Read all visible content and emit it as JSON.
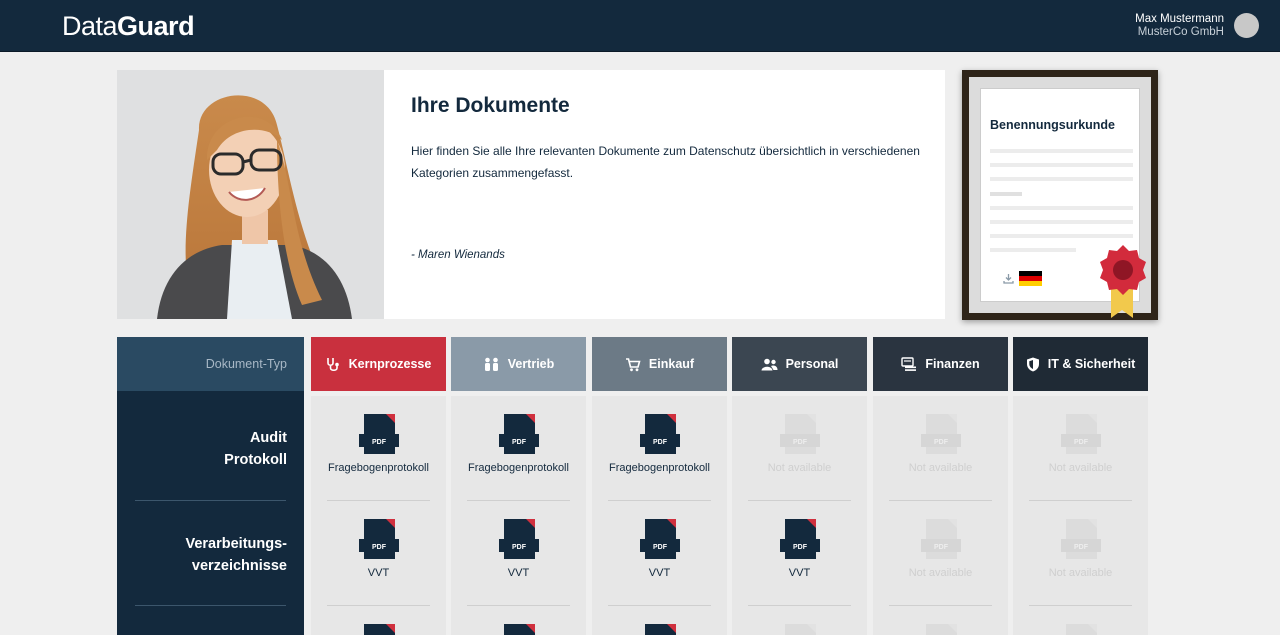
{
  "header": {
    "logo_part1": "Data",
    "logo_part2": "Guard",
    "user_name": "Max Mustermann",
    "company": "MusterCo GmbH"
  },
  "hero": {
    "title": "Ihre Dokumente",
    "text": "Hier finden Sie alle Ihre relevanten Dokumente zum Datenschutz übersichtlich in verschiedenen Kategorien zusammengefasst.",
    "quote": "- Maren Wienands"
  },
  "certificate": {
    "title": "Benennungsurkunde",
    "icon": "download-icon",
    "language_flag": "de-flag"
  },
  "table": {
    "corner_label": "Dokument-Typ",
    "columns": [
      {
        "label": "Kernprozesse",
        "color": "#c9303e",
        "icon": "stethoscope-icon"
      },
      {
        "label": "Vertrieb",
        "color": "#8a9aa8",
        "icon": "people-icon"
      },
      {
        "label": "Einkauf",
        "color": "#6c7a86",
        "icon": "cart-icon"
      },
      {
        "label": "Personal",
        "color": "#3b4651",
        "icon": "users-icon"
      },
      {
        "label": "Finanzen",
        "color": "#2a3440",
        "icon": "money-icon"
      },
      {
        "label": "IT & Sicherheit",
        "color": "#1f2a35",
        "icon": "shield-icon"
      }
    ],
    "rows": [
      {
        "label_line1": "Audit",
        "label_line2": "Protokoll",
        "cells": [
          "Fragebogenprotokoll",
          "Fragebogenprotokoll",
          "Fragebogenprotokoll",
          "Not available",
          "Not available",
          "Not available"
        ]
      },
      {
        "label_line1": "Verarbeitungs-",
        "label_line2": "verzeichnisse",
        "cells": [
          "VVT",
          "VVT",
          "VVT",
          "VVT",
          "Not available",
          "Not available"
        ]
      }
    ],
    "pdf_badge": "PDF"
  },
  "colors": {
    "navy": "#13293d",
    "accent_red": "#c9303e",
    "seal_gold": "#f2c94c"
  }
}
